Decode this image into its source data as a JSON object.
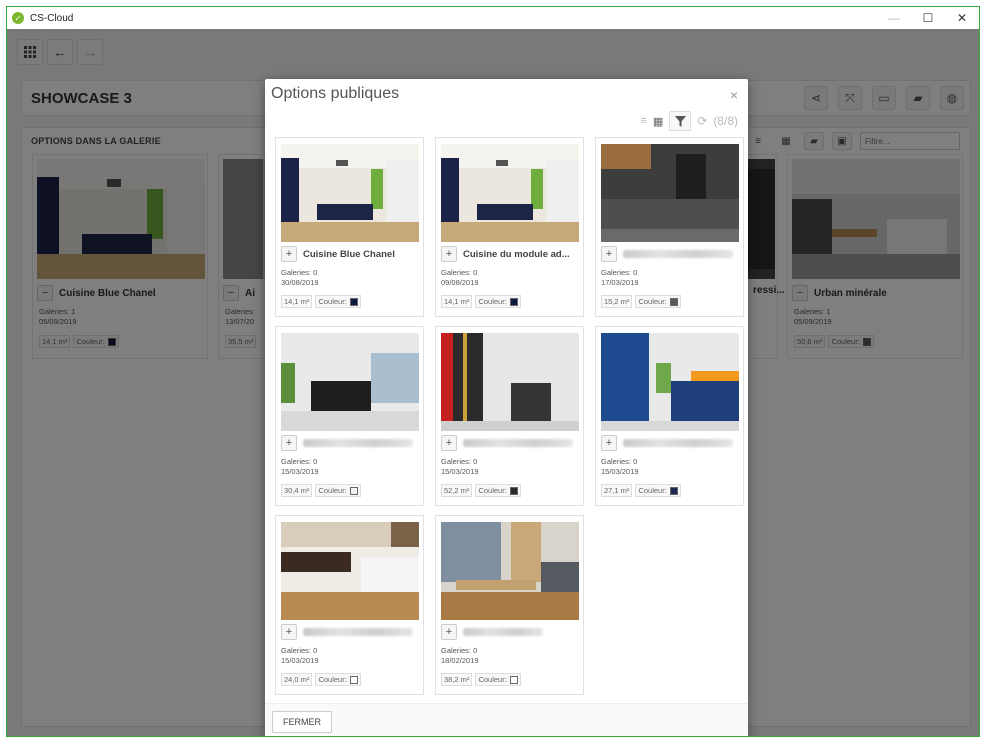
{
  "window": {
    "title": "CS-Cloud",
    "logo_icon": "cs-cloud-logo-icon",
    "minimize": "—",
    "maximize": "☐",
    "close": "✕"
  },
  "toolbar": {
    "menu_icon": "grid-menu-icon",
    "back_icon": "arrow-left-icon",
    "forward_icon": "arrow-right-icon"
  },
  "page": {
    "title": "SHOWCASE 3",
    "actions": [
      "share-icon",
      "fullscreen-icon",
      "presentation-icon",
      "folder-icon",
      "globe-icon"
    ]
  },
  "gallery": {
    "title": "OPTIONS DANS LA GALERIE",
    "filter_placeholder": "Filtre...",
    "cards": [
      {
        "name": "Cuisine Blue Chanel",
        "galleries": "Galeries: 1",
        "date": "05/09/2019",
        "area": "14,1 m²",
        "color_label": "Couleur:",
        "swatch": "#101a3a"
      },
      {
        "name": "Ai",
        "galleries": "Galeries:",
        "date": "13/07/20",
        "area": "35,5 m²",
        "color_label": "",
        "swatch": ""
      },
      {
        "name": "ressi...",
        "galleries": "",
        "date": "",
        "area": "",
        "color_label": "",
        "swatch": ""
      },
      {
        "name": "Urban minérale",
        "galleries": "Galeries: 1",
        "date": "05/09/2019",
        "area": "50,6 m²",
        "color_label": "Couleur:",
        "swatch": "#555555"
      }
    ]
  },
  "modal": {
    "title": "Options publiques",
    "close": "×",
    "counter": "(8/8)",
    "footer_button": "FERMER",
    "cards": [
      {
        "name": "Cuisine Blue Chanel",
        "blurred": false,
        "galleries": "Galeries: 0",
        "date": "30/08/2019",
        "area": "14,1 m²",
        "color_label": "Couleur:",
        "swatch": "#0f1a40"
      },
      {
        "name": "Cuisine du module ad...",
        "blurred": false,
        "galleries": "Galeries: 0",
        "date": "09/08/2019",
        "area": "14,1 m²",
        "color_label": "Couleur:",
        "swatch": "#0f1a40"
      },
      {
        "name": "",
        "blurred": true,
        "galleries": "Galeries: 0",
        "date": "17/03/2019",
        "area": "15,2 m²",
        "color_label": "Couleur:",
        "swatch": "#5a5a5a"
      },
      {
        "name": "",
        "blurred": true,
        "galleries": "Galeries: 0",
        "date": "15/03/2019",
        "area": "30,4 m²",
        "color_label": "Couleur:",
        "swatch": "#f2f2f2"
      },
      {
        "name": "",
        "blurred": true,
        "galleries": "Galeries: 0",
        "date": "15/03/2019",
        "area": "52,2 m²",
        "color_label": "Couleur:",
        "swatch": "#2b2b2b"
      },
      {
        "name": "",
        "blurred": true,
        "galleries": "Galeries: 0",
        "date": "15/03/2019",
        "area": "27,1 m²",
        "color_label": "Couleur:",
        "swatch": "#1c2a55"
      },
      {
        "name": "",
        "blurred": true,
        "galleries": "Galeries: 0",
        "date": "15/03/2019",
        "area": "24,0 m²",
        "color_label": "Couleur:",
        "swatch": "#ffffff"
      },
      {
        "name": "",
        "blurred": true,
        "galleries": "Galeries: 0",
        "date": "18/02/2019",
        "area": "38,2 m²",
        "color_label": "Couleur:",
        "swatch": "#ffffff"
      }
    ]
  }
}
